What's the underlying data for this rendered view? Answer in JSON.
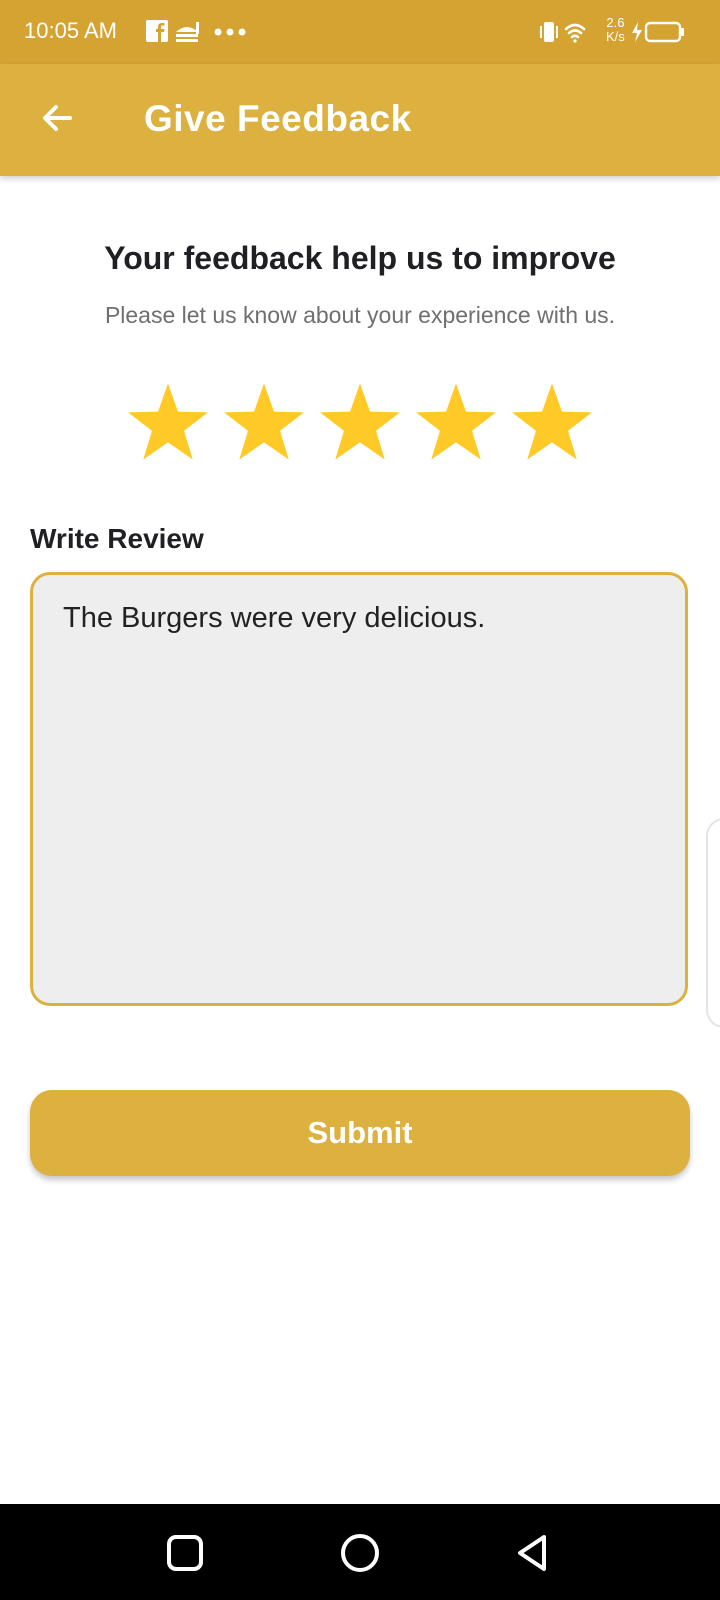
{
  "status_bar": {
    "time": "10:05 AM",
    "speed_value": "2.6",
    "speed_unit": "K/s",
    "left_icons": [
      "facebook-icon",
      "food-app-icon",
      "more-dots-icon"
    ],
    "right_icons": [
      "vibrate-icon",
      "wifi-icon",
      "charging-icon",
      "battery-icon"
    ]
  },
  "app_bar": {
    "title": "Give Feedback",
    "back_icon": "arrow-back-icon"
  },
  "feedback": {
    "headline": "Your feedback help us to improve",
    "subtext": "Please let us know about your experience with us.",
    "rating": 5,
    "max_rating": 5
  },
  "review": {
    "label": "Write Review",
    "value": "The Burgers were very delicious."
  },
  "submit": {
    "label": "Submit"
  },
  "nav_bar": {
    "buttons": [
      "recents-square-icon",
      "home-circle-icon",
      "back-triangle-icon"
    ]
  },
  "colors": {
    "status_bar": "#D4A332",
    "accent": "#DCB140",
    "star": "#FFC928",
    "input_bg": "#EEEEEE"
  }
}
